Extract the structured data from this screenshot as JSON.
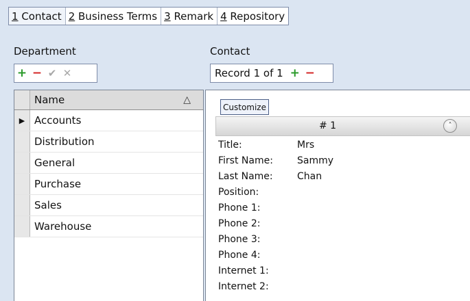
{
  "tabs": [
    {
      "accel": "1",
      "label": "Contact"
    },
    {
      "accel": "2",
      "label": "Business Terms"
    },
    {
      "accel": "3",
      "label": "Remark"
    },
    {
      "accel": "4",
      "label": "Repository"
    }
  ],
  "department": {
    "label": "Department",
    "buttons": {
      "add": "+",
      "remove": "−",
      "confirm": "✔",
      "cancel": "✕"
    },
    "column_header": "Name",
    "sort_icon": "sort-ascending-icon",
    "rows": [
      "Accounts",
      "Distribution",
      "General",
      "Purchase",
      "Sales",
      "Warehouse"
    ],
    "selected_index": 0
  },
  "contact": {
    "label": "Contact",
    "record_text": "Record 1 of 1",
    "buttons": {
      "add": "+",
      "remove": "−"
    },
    "customize_label": "Customize",
    "card_title": "# 1",
    "fields": [
      {
        "label": "Title:",
        "value": "Mrs"
      },
      {
        "label": "First Name:",
        "value": "Sammy"
      },
      {
        "label": "Last Name:",
        "value": "Chan"
      },
      {
        "label": "Position:",
        "value": ""
      },
      {
        "label": "Phone 1:",
        "value": ""
      },
      {
        "label": "Phone 2:",
        "value": ""
      },
      {
        "label": "Phone 3:",
        "value": ""
      },
      {
        "label": "Phone 4:",
        "value": ""
      },
      {
        "label": "Internet 1:",
        "value": ""
      },
      {
        "label": "Internet 2:",
        "value": ""
      }
    ]
  },
  "colors": {
    "add": "#2a9a2a",
    "remove": "#d32222",
    "background": "#dbe5f2"
  }
}
